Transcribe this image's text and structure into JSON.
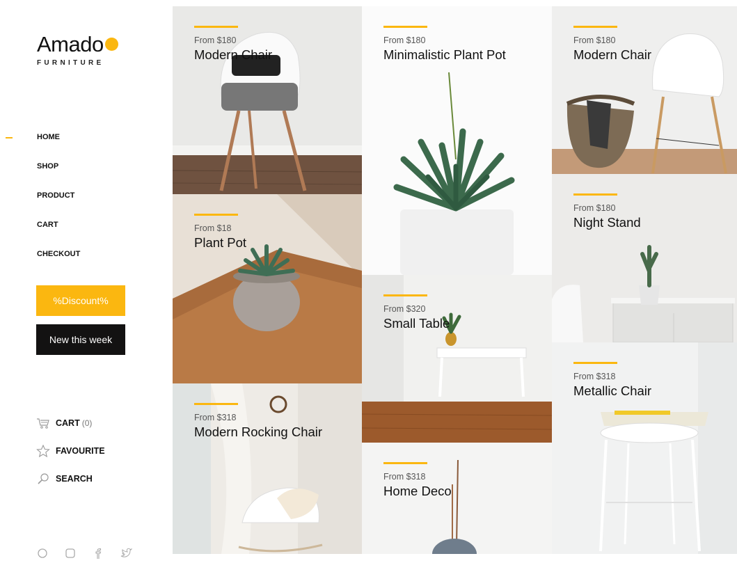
{
  "brand": {
    "name": "Amado",
    "tagline": "FURNITURE",
    "accent": "#fbb710"
  },
  "nav": [
    "HOME",
    "SHOP",
    "PRODUCT",
    "CART",
    "CHECKOUT"
  ],
  "buttons": {
    "discount": "%Discount%",
    "new_week": "New this week"
  },
  "utilities": {
    "cart": {
      "label": "CART",
      "count": "(0)",
      "icon": "cart-icon"
    },
    "favourite": {
      "label": "FAVOURITE",
      "icon": "star-icon"
    },
    "search": {
      "label": "SEARCH",
      "icon": "search-icon"
    }
  },
  "social": [
    "pinterest-icon",
    "instagram-icon",
    "facebook-icon",
    "twitter-icon"
  ],
  "products": [
    {
      "price": "From $180",
      "name": "Modern Chair"
    },
    {
      "price": "From $18",
      "name": "Plant Pot"
    },
    {
      "price": "From $318",
      "name": "Modern Rocking Chair"
    },
    {
      "price": "From $180",
      "name": "Minimalistic Plant Pot"
    },
    {
      "price": "From $320",
      "name": "Small Table"
    },
    {
      "price": "From $318",
      "name": "Home Deco"
    },
    {
      "price": "From $180",
      "name": "Modern Chair"
    },
    {
      "price": "From $180",
      "name": "Night Stand"
    },
    {
      "price": "From $318",
      "name": "Metallic Chair"
    }
  ]
}
